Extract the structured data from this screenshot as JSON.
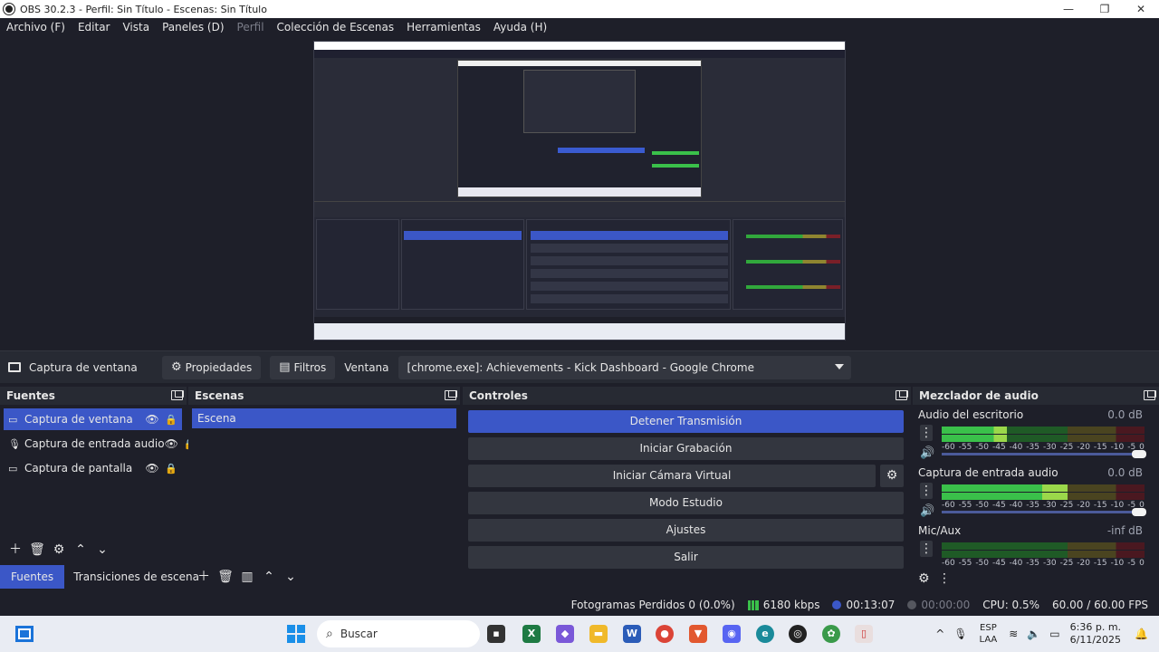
{
  "window": {
    "title": "OBS 30.2.3 - Perfil: Sin Título - Escenas: Sin Título",
    "controls": [
      "—",
      "❐",
      "✕"
    ]
  },
  "menu": {
    "items": [
      "Archivo (F)",
      "Editar",
      "Vista",
      "Paneles (D)",
      "Perfil",
      "Colección de Escenas",
      "Herramientas",
      "Ayuda (H)"
    ]
  },
  "source_toolbar": {
    "source_name": "Captura de ventana",
    "properties_label": "Propiedades",
    "filters_label": "Filtros",
    "window_label": "Ventana",
    "window_value": "[chrome.exe]: Achievements - Kick Dashboard - Google Chrome"
  },
  "docks": {
    "fuentes": {
      "title": "Fuentes",
      "items": [
        {
          "label": "Captura de ventana",
          "icon": "monitor-icon",
          "selected": true
        },
        {
          "label": "Captura de entrada audio",
          "icon": "microphone-icon",
          "selected": false
        },
        {
          "label": "Captura de pantalla",
          "icon": "monitor-icon",
          "selected": false
        }
      ]
    },
    "escenas": {
      "title": "Escenas",
      "items": [
        "Escena"
      ]
    },
    "controles": {
      "title": "Controles",
      "buttons": {
        "stop_stream": "Detener Transmisión",
        "start_recording": "Iniciar Grabación",
        "start_virtual_cam": "Iniciar Cámara Virtual",
        "studio_mode": "Modo Estudio",
        "settings": "Ajustes",
        "exit": "Salir"
      }
    },
    "mezclador": {
      "title": "Mezclador de audio",
      "channels": [
        {
          "name": "Audio del escritorio",
          "db": "0.0 dB",
          "level": 0.32
        },
        {
          "name": "Captura de entrada audio",
          "db": "0.0 dB",
          "level": 0.62
        },
        {
          "name": "Mic/Aux",
          "db": "-inf dB",
          "level": 0.0
        }
      ],
      "ticks": [
        "-60",
        "-55",
        "-50",
        "-45",
        "-40",
        "-35",
        "-30",
        "-25",
        "-20",
        "-15",
        "-10",
        "-5",
        "0"
      ]
    }
  },
  "tabs": {
    "fuentes": "Fuentes",
    "transiciones": "Transiciones de escena"
  },
  "status": {
    "frames_dropped": "Fotogramas Perdidos 0 (0.0%)",
    "bitrate": "6180 kbps",
    "stream_time": "00:13:07",
    "rec_time": "00:00:00",
    "cpu": "CPU: 0.5%",
    "fps": "60.00 / 60.00 FPS"
  },
  "taskbar": {
    "search_placeholder": "Buscar",
    "lang_line1": "ESP",
    "lang_line2": "LAA",
    "time": "6:36 p. m.",
    "date": "6/11/2025"
  },
  "colors": {
    "accent": "#3b57c7",
    "background": "#1e1f29",
    "panel": "#272a33",
    "meter_green": "#3ac04a"
  }
}
